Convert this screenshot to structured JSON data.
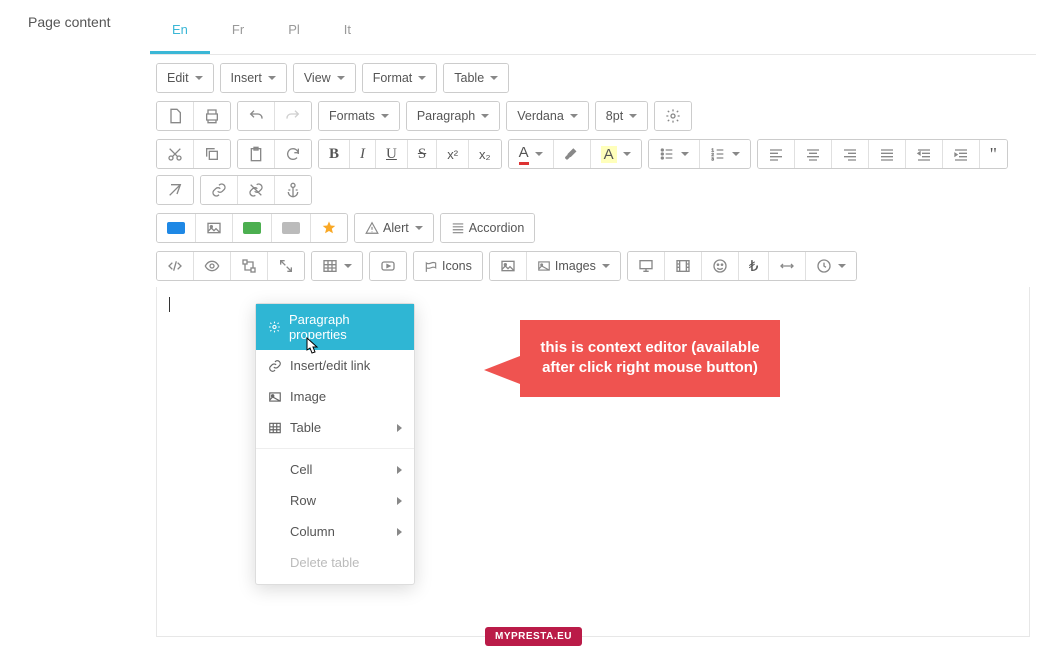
{
  "label": "Page content",
  "tabs": [
    "En",
    "Fr",
    "Pl",
    "It"
  ],
  "active_tab": 0,
  "menubar": [
    "Edit",
    "Insert",
    "View",
    "Format",
    "Table"
  ],
  "row2": {
    "formats": "Formats",
    "paragraph": "Paragraph",
    "font": "Verdana",
    "size": "8pt"
  },
  "row4": {
    "alert": "Alert",
    "accordion": "Accordion"
  },
  "row5": {
    "icons": "Icons",
    "images": "Images"
  },
  "context_menu": {
    "paragraph_props": "Paragraph properties",
    "link": "Insert/edit link",
    "image": "Image",
    "table": "Table",
    "cell": "Cell",
    "row": "Row",
    "column": "Column",
    "delete": "Delete table"
  },
  "callout": "this is context editor (available after click right mouse button)",
  "badge": "MYPRESTA.EU"
}
